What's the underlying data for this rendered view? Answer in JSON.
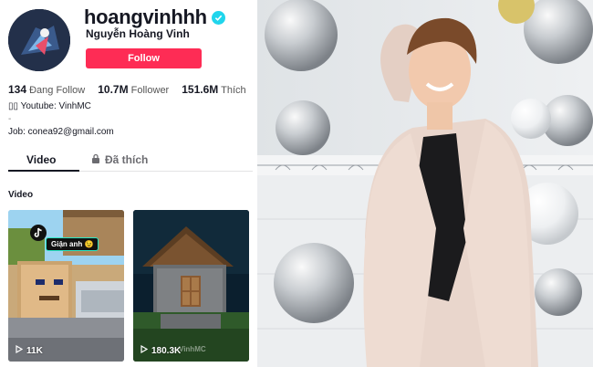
{
  "profile": {
    "username": "hoangvinhhh",
    "display_name": "Nguyễn Hoàng Vinh",
    "follow_label": "Follow"
  },
  "stats": {
    "following_count": "134",
    "following_label": "Đang Follow",
    "followers_count": "10.7M",
    "followers_label": "Follower",
    "likes_count": "151.6M",
    "likes_label": "Thích"
  },
  "bio": {
    "line1": "▯▯ Youtube: VinhMC",
    "line2": "-",
    "line3": "Job: conea92@gmail.com"
  },
  "tabs": {
    "video": "Video",
    "liked": "Đã thích"
  },
  "videos": {
    "section_label": "Video",
    "items": [
      {
        "views": "11K",
        "caption_badge": "Giận anh 😉"
      },
      {
        "views": "180.3K",
        "watermark": "VinhMC"
      }
    ]
  },
  "colors": {
    "accent": "#fe2c55",
    "verified": "#20d5ec"
  }
}
